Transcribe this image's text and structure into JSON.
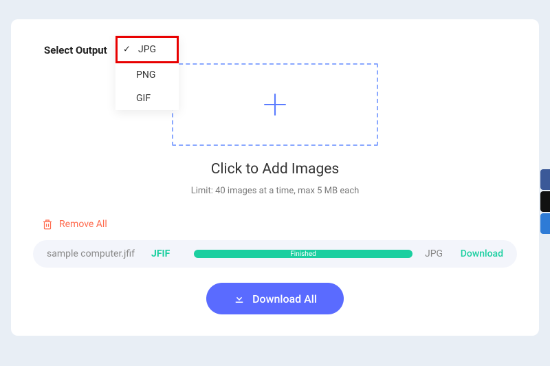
{
  "select_label": "Select Output",
  "dropdown": {
    "options": [
      "JPG",
      "PNG",
      "GIF"
    ],
    "selected": "JPG"
  },
  "dropzone": {
    "heading": "Click to Add Images",
    "limit": "Limit: 40 images at a time, max 5 MB each"
  },
  "remove_all": "Remove All",
  "file": {
    "name": "sample computer.jfif",
    "source_format": "JFIF",
    "progress_label": "Finished",
    "target_format": "JPG",
    "download_label": "Download"
  },
  "download_all": "Download All"
}
